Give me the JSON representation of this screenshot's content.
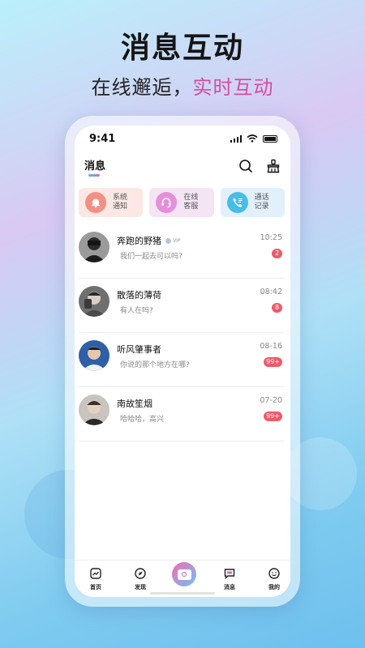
{
  "promo": {
    "headline": "消息互动",
    "subline_part1": "在线邂逅，",
    "subline_part2": "实时互动"
  },
  "statusbar": {
    "time": "9:41"
  },
  "header": {
    "title": "消息"
  },
  "quick_actions": [
    {
      "label": "系统通知",
      "icon": "bell-icon"
    },
    {
      "label": "在线客服",
      "icon": "headset-icon"
    },
    {
      "label": "通话记录",
      "icon": "phone-call-icon"
    }
  ],
  "conversations": [
    {
      "name": "奔跑的野猪",
      "vip": "VIP",
      "message": "我们一起去可以吗?",
      "time": "10:25",
      "unread": "2"
    },
    {
      "name": "散落的薄荷",
      "message": "有人在吗?",
      "time": "08:42",
      "unread": "8"
    },
    {
      "name": "听风肇事者",
      "message": "你说的那个地方在哪?",
      "time": "08-16",
      "unread": "99+"
    },
    {
      "name": "南故笙烟",
      "message": "哈哈哈，高兴",
      "time": "07-20",
      "unread": "99+"
    }
  ],
  "tabbar": {
    "home": "首页",
    "discover": "发现",
    "messages": "消息",
    "mine": "我的"
  },
  "colors": {
    "accent_pink": "#d24fa0",
    "badge_red": "#ef5a6b",
    "system_icon": "#f39083",
    "service_icon": "#e58fd9",
    "calls_icon": "#47bde8"
  }
}
